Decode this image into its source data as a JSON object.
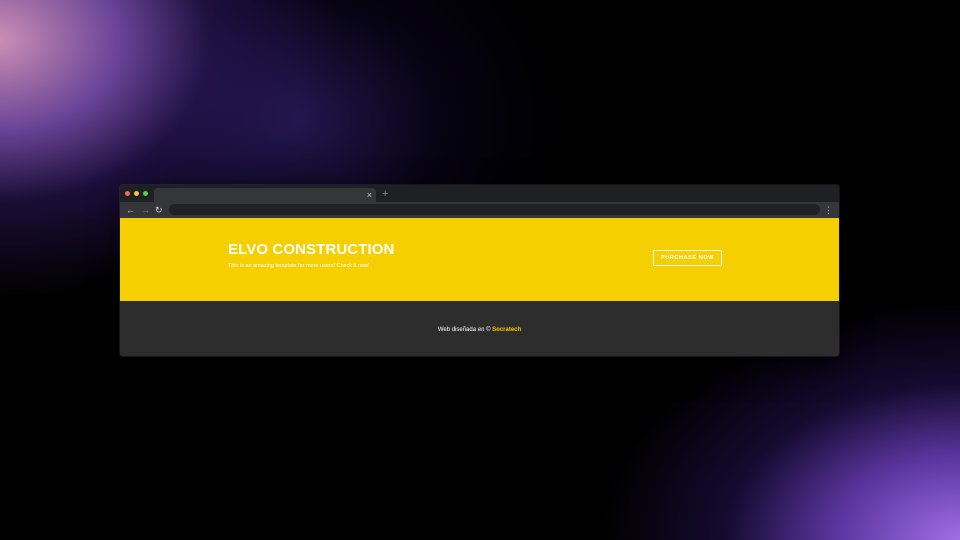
{
  "browser": {
    "tab_close": "×",
    "new_tab": "+",
    "back_icon": "←",
    "forward_icon": "→",
    "reload_icon": "↻",
    "menu_icon": "⋮"
  },
  "hero": {
    "title": "ELVO CONSTRUCTION",
    "subtitle": "This is an amazing template for more users! Check it now!",
    "button_label": "PURCHASE NOW",
    "background_color": "#f6cf00"
  },
  "footer": {
    "text": "Web diseñada en ©",
    "link_text": "Socratech",
    "link_color": "#f6cf00",
    "background_color": "#2d2d2d"
  }
}
